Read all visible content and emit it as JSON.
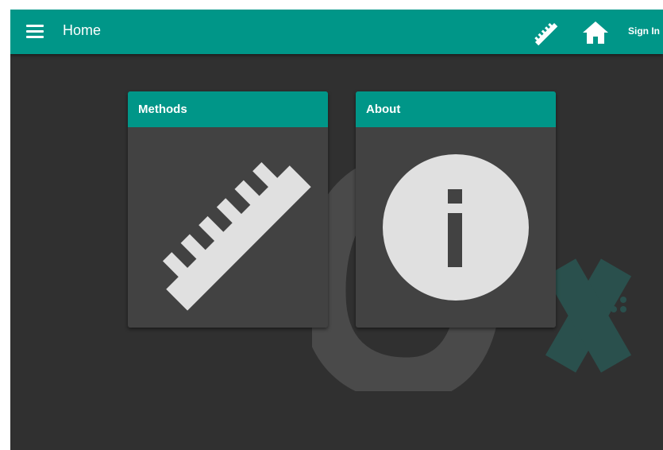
{
  "header": {
    "title": "Home",
    "menu_icon": "hamburger-menu-icon",
    "ruler_icon": "ruler-icon",
    "home_icon": "home-icon",
    "signin_label": "Sign In"
  },
  "cards": [
    {
      "title": "Methods",
      "icon": "ruler-icon"
    },
    {
      "title": "About",
      "icon": "info-icon"
    }
  ],
  "colors": {
    "accent": "#009688",
    "background": "#303030",
    "card": "#424242",
    "icon": "#e0e0e0"
  }
}
